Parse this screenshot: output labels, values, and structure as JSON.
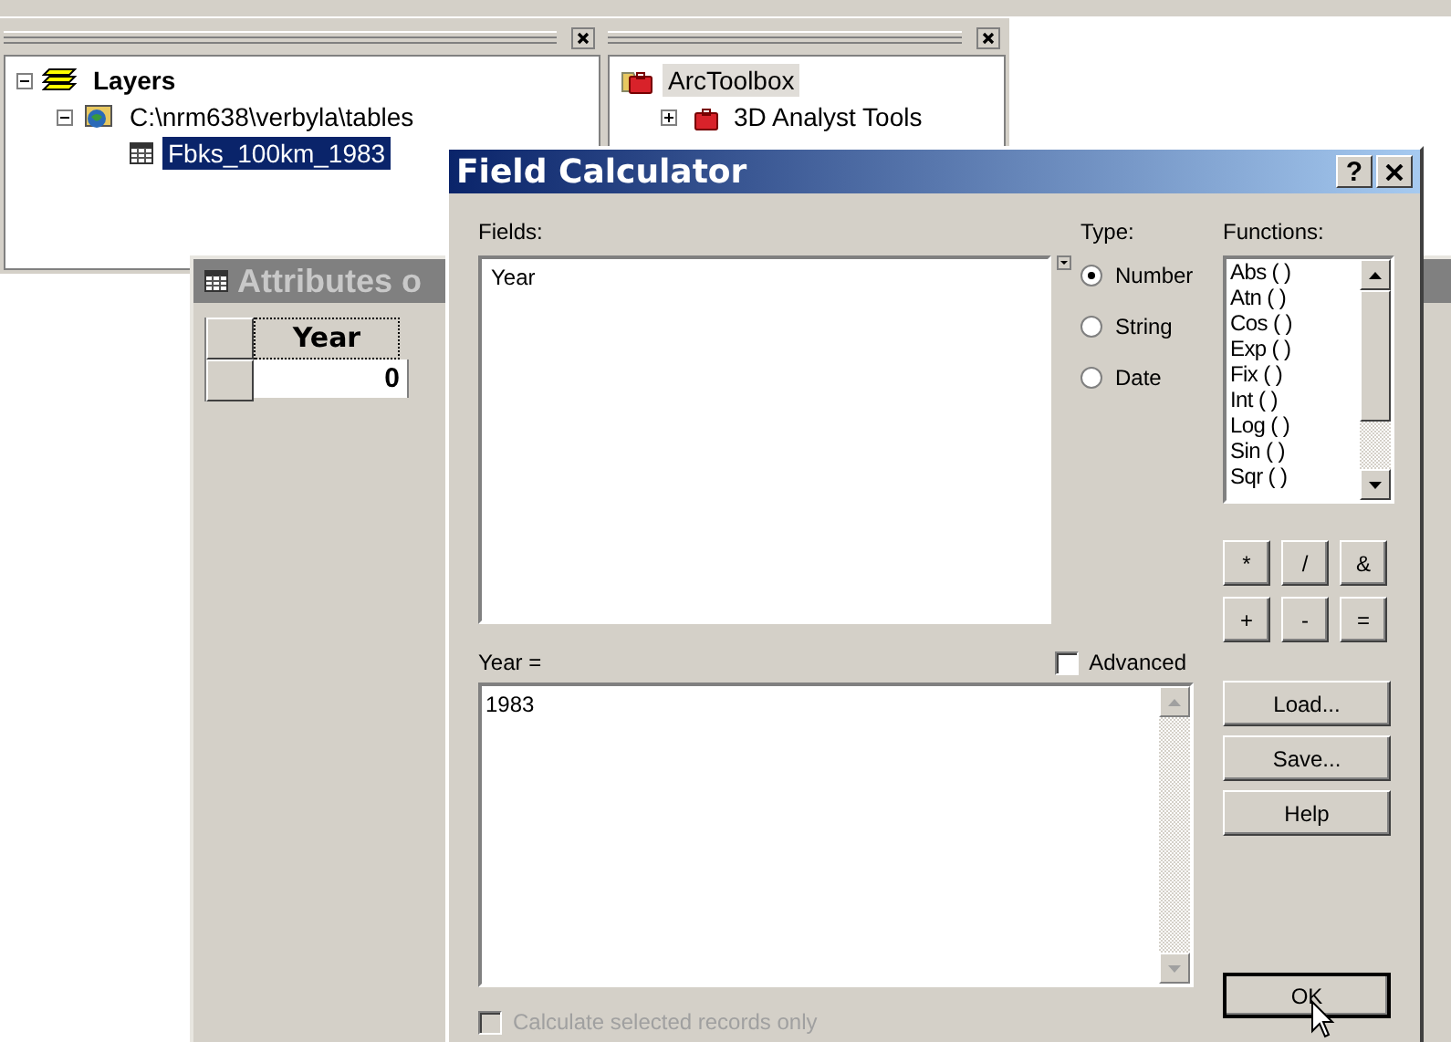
{
  "toc": {
    "items": [
      {
        "label": "Layers",
        "expanded": true,
        "children": [
          {
            "label": "C:\\nrm638\\verbyla\\tables",
            "expanded": true,
            "children": [
              {
                "label": "Fbks_100km_1983",
                "selected": true
              }
            ]
          }
        ]
      }
    ]
  },
  "toolbox": {
    "items": [
      {
        "label": "ArcToolbox",
        "selected": true
      },
      {
        "label": "3D Analyst Tools",
        "expanded": false
      }
    ]
  },
  "attributes": {
    "title": "Attributes o",
    "columns": [
      "Year"
    ],
    "rows": [
      [
        "0"
      ]
    ]
  },
  "dialog": {
    "title": "Field Calculator",
    "help_button": "?",
    "fields_label": "Fields:",
    "fields": [
      {
        "label": "Year",
        "selected": false
      }
    ],
    "type_label": "Type:",
    "types": [
      {
        "label": "Number",
        "selected": true
      },
      {
        "label": "String",
        "selected": false
      },
      {
        "label": "Date",
        "selected": false
      }
    ],
    "functions_label": "Functions:",
    "functions": [
      "Abs ( )",
      "Atn ( )",
      "Cos ( )",
      "Exp ( )",
      "Fix ( )",
      "Int ( )",
      "Log ( )",
      "Sin ( )",
      "Sqr ( )"
    ],
    "operators": [
      "*",
      "/",
      "&",
      "+",
      "-",
      "="
    ],
    "expression_label": "Year =",
    "advanced": {
      "label": "Advanced",
      "checked": false
    },
    "expression": "1983",
    "buttons": [
      "Load...",
      "Save...",
      "Help",
      "OK"
    ],
    "selected_only": {
      "label": "Calculate selected records only",
      "checked": false,
      "disabled": true
    }
  }
}
